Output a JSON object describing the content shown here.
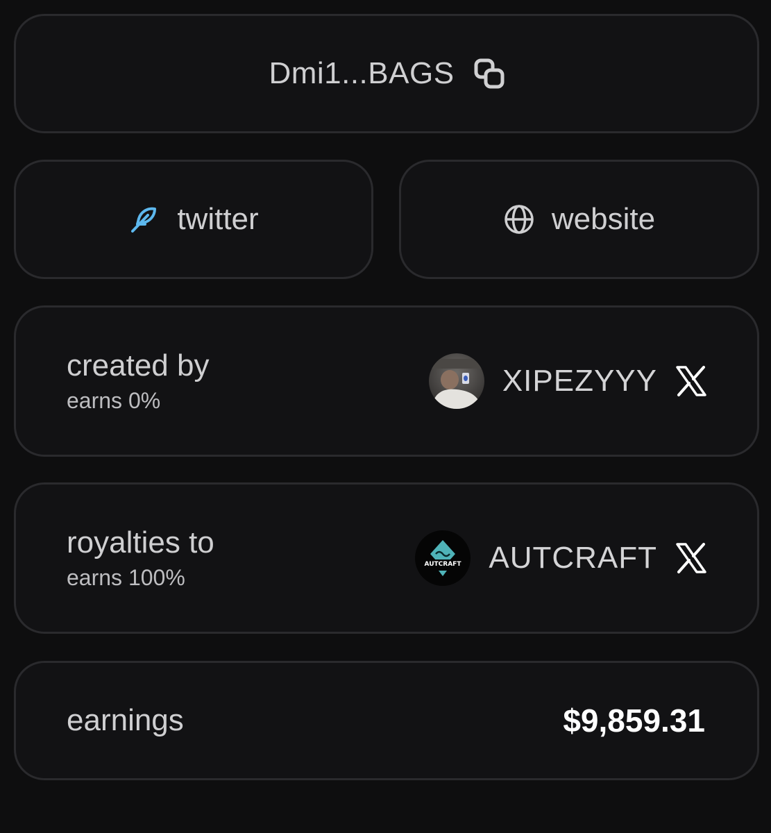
{
  "address": {
    "short": "Dmi1...BAGS",
    "copy_icon": "copy-icon"
  },
  "links": {
    "twitter": {
      "label": "twitter",
      "icon": "feather-icon",
      "icon_color": "#5db8ee"
    },
    "website": {
      "label": "website",
      "icon": "globe-icon"
    }
  },
  "creator": {
    "title": "created by",
    "subtitle": "earns 0%",
    "handle": "XIPEZYYY",
    "social_icon": "x-logo-icon"
  },
  "royalties": {
    "title": "royalties to",
    "subtitle": "earns 100%",
    "handle": "AUTCRAFT",
    "avatar_text": "AUTCRAFT",
    "social_icon": "x-logo-icon"
  },
  "earnings": {
    "label": "earnings",
    "value": "$9,859.31"
  },
  "colors": {
    "background": "#0e0e0f",
    "card": "#121214",
    "border": "#2a2a2d",
    "accent": "#5db8ee",
    "logo_teal": "#4fb3b8"
  }
}
